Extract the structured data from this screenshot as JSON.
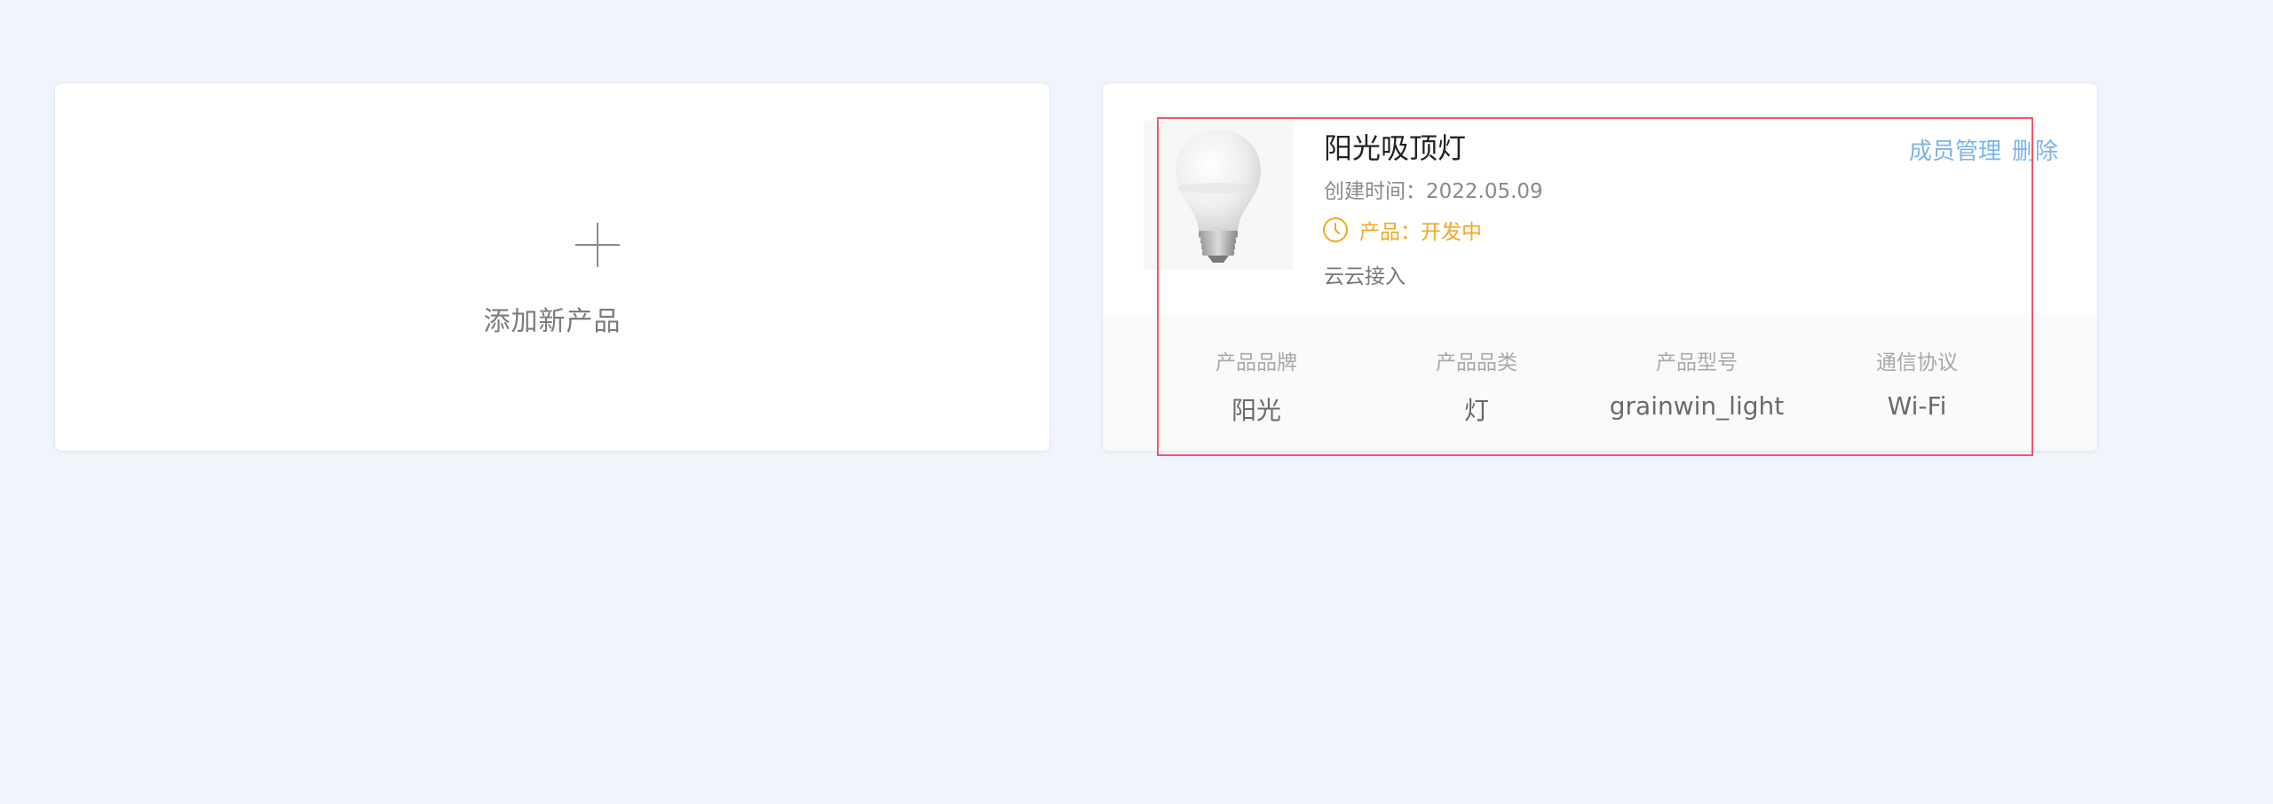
{
  "add_card": {
    "label": "添加新产品",
    "icon": "plus-icon"
  },
  "product": {
    "name": "阳光吸顶灯",
    "created_label": "创建时间：",
    "created_date": "2022.05.09",
    "status_text": "产品：开发中",
    "status_color": "#f5a623",
    "access": "云云接入",
    "actions": {
      "members": "成员管理",
      "delete": "删除"
    },
    "specs": [
      {
        "label": "产品品牌",
        "value": "阳光"
      },
      {
        "label": "产品品类",
        "value": "灯"
      },
      {
        "label": "产品型号",
        "value": "grainwin_light"
      },
      {
        "label": "通信协议",
        "value": "Wi-Fi"
      }
    ]
  },
  "colors": {
    "background": "#f0f4fb",
    "accent_link": "#7ab4ea",
    "highlight": "#f0566a"
  }
}
